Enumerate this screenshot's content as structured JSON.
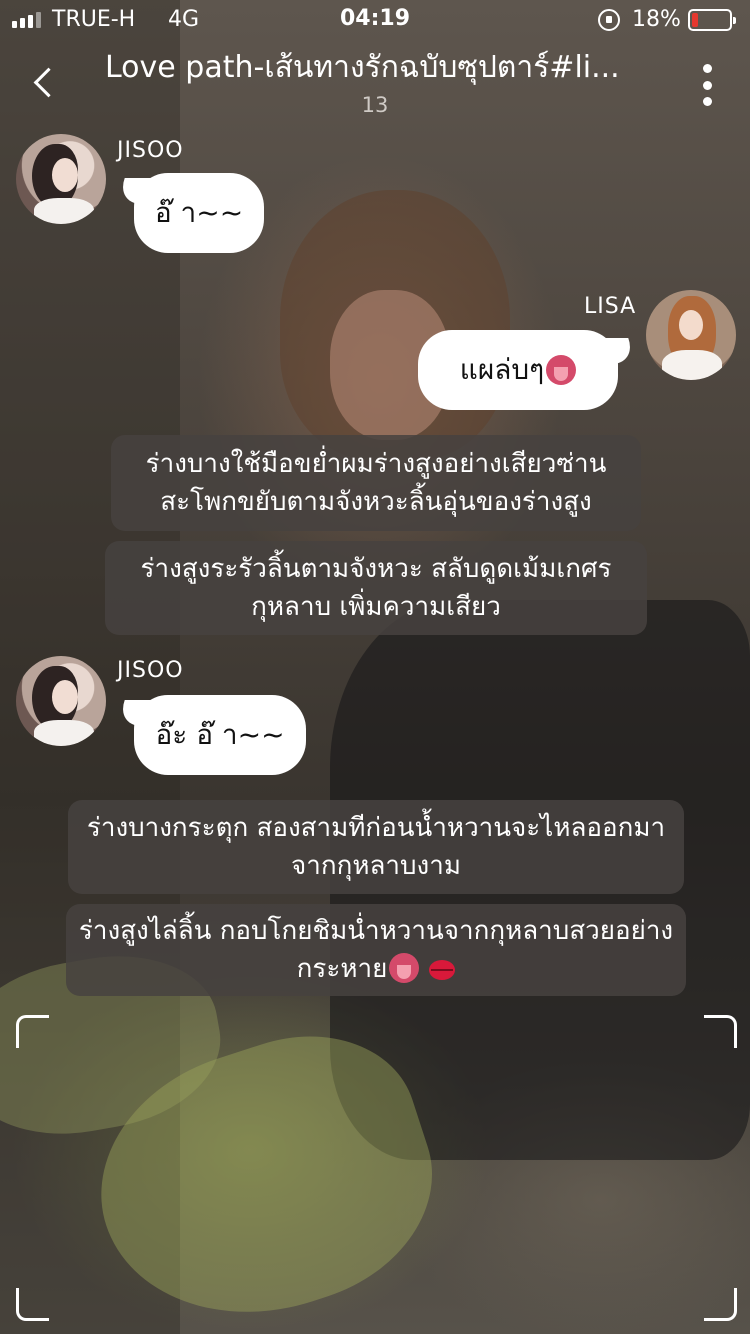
{
  "status_bar": {
    "carrier": "TRUE-H",
    "network": "4G",
    "time": "04:19",
    "battery_percent": "18%",
    "battery_level": 0.18,
    "battery_color": "#e5382f"
  },
  "header": {
    "title": "Love path-เส้นทางรักฉบับซุปตาร์#li...",
    "episode": "13",
    "back_icon": "chevron-left-icon",
    "more_icon": "more-vertical-icon"
  },
  "messages": [
    {
      "type": "chat",
      "side": "left",
      "sender": "JISOO",
      "text": "อ๊ า~~"
    },
    {
      "type": "chat",
      "side": "right",
      "sender": "LISA",
      "text": "แผล่บๆ",
      "emoji": "tongue-emoji"
    },
    {
      "type": "narration",
      "text": "ร่างบางใช้มือขย่ำผมร่างสูงอย่างเสียวซ่าน สะโพกขยับตามจังหวะลิ้นอุ่นของร่างสูง"
    },
    {
      "type": "narration",
      "text": "ร่างสูงระรัวลิ้นตามจังหวะ  สลับดูดเม้มเกศรกุหลาบ เพิ่มความเสียว"
    },
    {
      "type": "chat",
      "side": "left",
      "sender": "JISOO",
      "text": "อ๊ะ อ๊ า~~"
    },
    {
      "type": "narration",
      "text": "ร่างบางกระตุก สองสามทีก่อนน้ำหวานจะไหลออกมา จากกุหลาบงาม"
    },
    {
      "type": "narration",
      "text": "ร่างสูงไล่ลิ้น กอบโกยชิมน่ำหวานจากกุหลาบสวยอย่างกระหาย",
      "emoji": [
        "tongue-emoji",
        "kiss-emoji"
      ]
    }
  ]
}
